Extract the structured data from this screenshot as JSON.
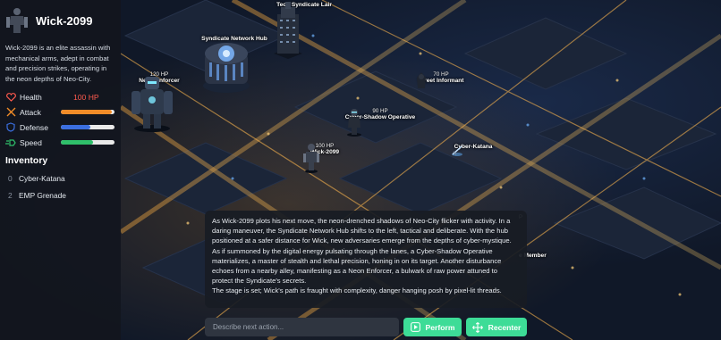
{
  "character": {
    "name": "Wick-2099",
    "description": "Wick-2099 is an elite assassin with mechanical arms, adept in combat and precision strikes, operating in the neon depths of Neo-City.",
    "stats": {
      "health_label": "Health",
      "health_value": "100 HP",
      "attack_label": "Attack",
      "attack_level": 0.95,
      "defense_label": "Defense",
      "defense_level": 0.55,
      "speed_label": "Speed",
      "speed_level": 0.6
    },
    "colors": {
      "health": "#ff5a4e",
      "attack": "#f28c28",
      "defense": "#3b6fe0",
      "speed": "#2fbf6a"
    }
  },
  "inventory": {
    "title": "Inventory",
    "items": [
      {
        "index": "0",
        "name": "Cyber-Katana"
      },
      {
        "index": "2",
        "name": "EMP Grenade"
      }
    ]
  },
  "map": {
    "entities": [
      {
        "name": "Tech Syndicate Lair",
        "hp": "",
        "icon": "tower-icon"
      },
      {
        "name": "Syndicate Network Hub",
        "hp": "",
        "icon": "hub-icon"
      },
      {
        "name": "Neon Enforcer",
        "hp": "120 HP",
        "icon": "robot-icon"
      },
      {
        "name": "Street Informant",
        "hp": "70 HP",
        "icon": "hooded-figure-icon"
      },
      {
        "name": "Cyber-Shadow Operative",
        "hp": "90 HP",
        "icon": "operative-icon"
      },
      {
        "name": "Wick-2099",
        "hp": "100 HP",
        "icon": "assassin-icon"
      },
      {
        "name": "Cyber-Katana",
        "hp": "",
        "icon": "katana-icon"
      },
      {
        "name": "e Member",
        "hp": "P",
        "icon": ""
      }
    ]
  },
  "narrative": {
    "paragraphs": [
      "As Wick-2099 plots his next move, the neon-drenched shadows of Neo-City flicker with activity. In a daring maneuver, the Syndicate Network Hub shifts to the left, tactical and deliberate. With the hub positioned at a safer distance for Wick, new adversaries emerge from the depths of cyber-mystique. As if summoned by the digital energy pulsating through the lanes, a Cyber-Shadow Operative materializes, a master of stealth and lethal precision, honing in on its target. Another disturbance echoes from a nearby alley, manifesting as a Neon Enforcer, a bulwark of raw power attuned to protect the Syndicate's secrets.",
      "The stage is set; Wick's path is fraught with complexity, danger hanging posh by pixel-lit threads."
    ]
  },
  "actions": {
    "input_placeholder": "Describe next action...",
    "perform_label": "Perform",
    "recenter_label": "Recenter",
    "accent": "#3ddc97"
  }
}
